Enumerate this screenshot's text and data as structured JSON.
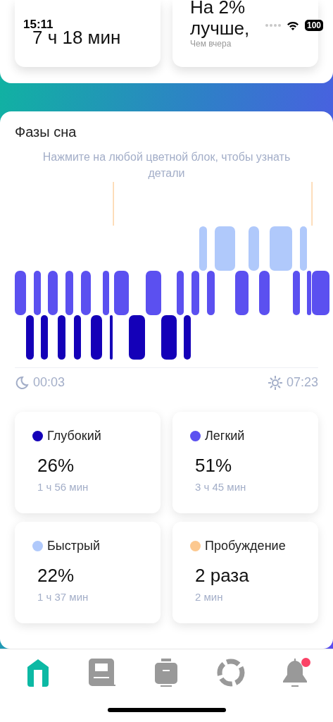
{
  "status_bar": {
    "time": "15:11",
    "battery": "100"
  },
  "summary": {
    "duration": "7 ч 18 мин",
    "comparison": "На 2% лучше,",
    "comparison_note": "Чем вчера"
  },
  "phases": {
    "title": "Фазы сна",
    "hint": "Нажмите на любой цветной блок, чтобы узнать детали",
    "start_time": "00:03",
    "end_time": "07:23"
  },
  "stages": [
    {
      "name": "Глубокий",
      "color": "#1400b8",
      "percent": "26%",
      "duration": "1 ч 56 мин"
    },
    {
      "name": "Легкий",
      "color": "#5b50f0",
      "percent": "51%",
      "duration": "3 ч 45 мин"
    },
    {
      "name": "Быстрый",
      "color": "#b0c9fb",
      "percent": "22%",
      "duration": "1 ч 37 мин"
    },
    {
      "name": "Пробуждение",
      "color": "#fcc88f",
      "percent": "2 раза",
      "duration": "2 мин"
    }
  ],
  "tab_bar": [
    {
      "selected": true,
      "badge": false
    },
    {
      "selected": false,
      "badge": false
    },
    {
      "selected": false,
      "badge": false
    },
    {
      "selected": false,
      "badge": false
    },
    {
      "selected": false,
      "badge": true
    }
  ]
}
